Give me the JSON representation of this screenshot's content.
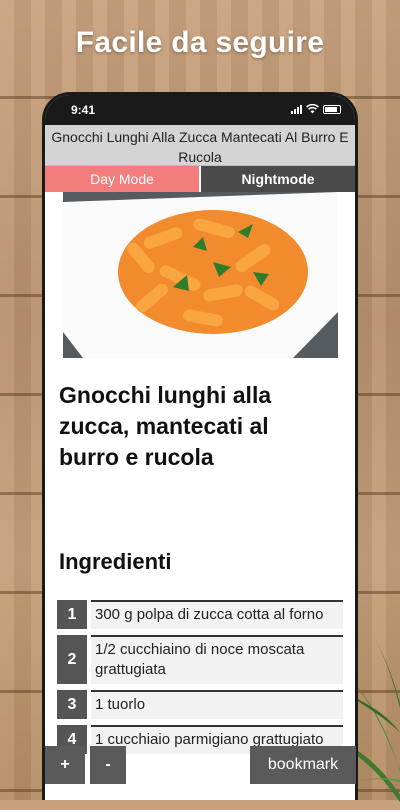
{
  "promo": {
    "headline": "Facile da seguire"
  },
  "status_bar": {
    "time": "9:41"
  },
  "app": {
    "title": "Gnocchi Lunghi Alla Zucca Mantecati Al Burro E Rucola",
    "modes": {
      "day_label": "Day Mode",
      "night_label": "Nightmode",
      "active": "day"
    }
  },
  "recipe": {
    "image_alt": "Gnocchi lunghi alla zucca con rucola",
    "title": "Gnocchi lunghi alla zucca, mantecati al burro e rucola",
    "ingredients_heading": "Ingredienti",
    "ingredients": [
      {
        "num": "1",
        "text": "300 g polpa di zucca cotta al forno"
      },
      {
        "num": "2",
        "text": "1/2 cucchiaino di noce moscata grattugiata"
      },
      {
        "num": "3",
        "text": "1 tuorlo"
      },
      {
        "num": "4",
        "text": "1 cucchiaio parmigiano grattugiato"
      }
    ]
  },
  "controls": {
    "plus_label": "+",
    "minus_label": "-",
    "bookmark_label": "bookmark"
  },
  "colors": {
    "day_mode": "#f37d7d",
    "night_mode": "#4a4a4a",
    "buttons": "#5a5a5a"
  }
}
